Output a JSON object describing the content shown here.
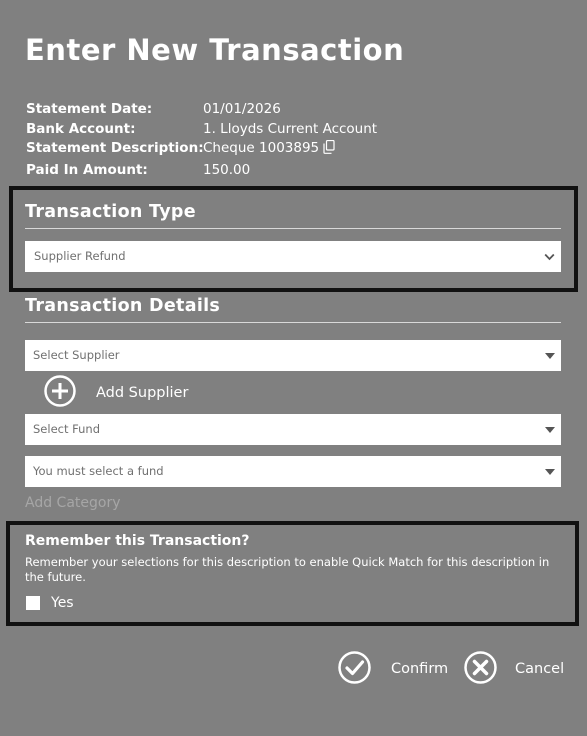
{
  "title": "Enter New Transaction",
  "statement": {
    "rows": [
      {
        "label": "Statement Date:",
        "value": "01/01/2026"
      },
      {
        "label": "Bank Account:",
        "value": "1. Lloyds Current Account"
      },
      {
        "label": "Statement Description:",
        "value": "Cheque 1003895"
      },
      {
        "label": "Paid In Amount:",
        "value": "150.00"
      }
    ]
  },
  "transaction_type": {
    "heading": "Transaction Type",
    "selected": "Supplier Refund"
  },
  "transaction_details": {
    "heading": "Transaction Details",
    "supplier_placeholder": "Select Supplier",
    "add_supplier_label": "Add Supplier",
    "fund_placeholder": "Select Fund",
    "category_placeholder": "You must select a fund",
    "add_category_label": "Add Category"
  },
  "remember": {
    "title": "Remember this Transaction?",
    "description": "Remember your selections for this description to enable Quick Match for this description in the future.",
    "checkbox_label": "Yes"
  },
  "actions": {
    "confirm_label": "Confirm",
    "cancel_label": "Cancel"
  },
  "icons": {
    "copy": "copy-icon",
    "add": "plus-circle-icon",
    "confirm": "check-circle-icon",
    "cancel": "x-circle-icon",
    "dropdown": "chevron-down-icon"
  },
  "colors": {
    "background": "#808080",
    "text": "#ffffff",
    "highlight_border": "#111111",
    "muted_text": "#a6a6a6"
  }
}
